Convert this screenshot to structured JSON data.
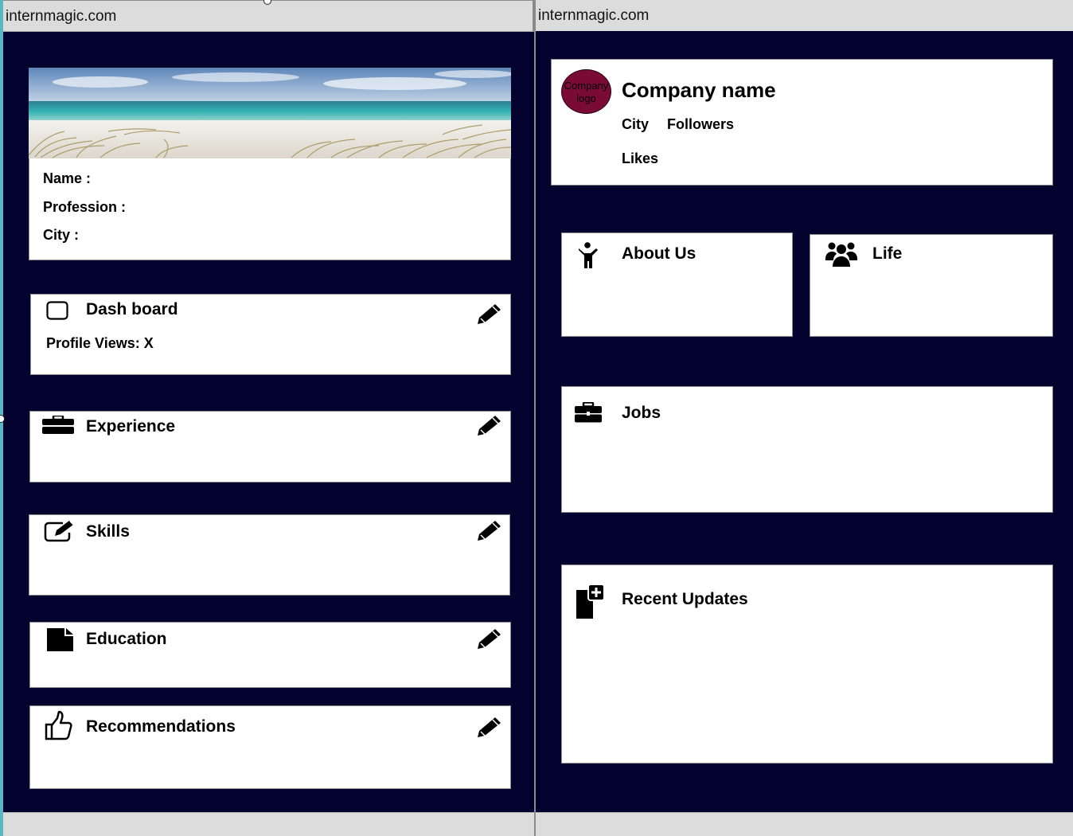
{
  "left_panel": {
    "url": "internmagic.com",
    "profile": {
      "name_label": "Name :",
      "profession_label": "Profession :",
      "city_label": "City :"
    },
    "sections": {
      "dashboard": {
        "title": "Dash board",
        "profile_views": "Profile Views: X"
      },
      "experience": {
        "title": "Experience"
      },
      "skills": {
        "title": "Skills"
      },
      "education": {
        "title": "Education"
      },
      "recommendations": {
        "title": "Recommendations"
      }
    },
    "icons": {
      "dashboard": "checkbox-icon",
      "experience": "briefcase-icon",
      "skills": "edit-square-icon",
      "education": "file-icon",
      "recommendations": "thumbs-up-icon",
      "edit": "pencil-icon"
    }
  },
  "right_panel": {
    "url": "internmagic.com",
    "company": {
      "logo_text": "Company logo",
      "name": "Company name",
      "city_label": "City",
      "followers_label": "Followers",
      "likes_label": "Likes"
    },
    "sections": {
      "about": {
        "title": "About Us"
      },
      "life": {
        "title": "Life"
      },
      "jobs": {
        "title": "Jobs"
      },
      "updates": {
        "title": "Recent Updates"
      }
    },
    "icons": {
      "about": "person-icon",
      "life": "group-icon",
      "jobs": "briefcase-icon",
      "updates": "add-document-icon"
    }
  },
  "colors": {
    "canvas_background": "#03022f",
    "card_background": "#ffffff",
    "logo_fill": "#7a0b34",
    "browser_chrome": "#dcdcdc"
  }
}
